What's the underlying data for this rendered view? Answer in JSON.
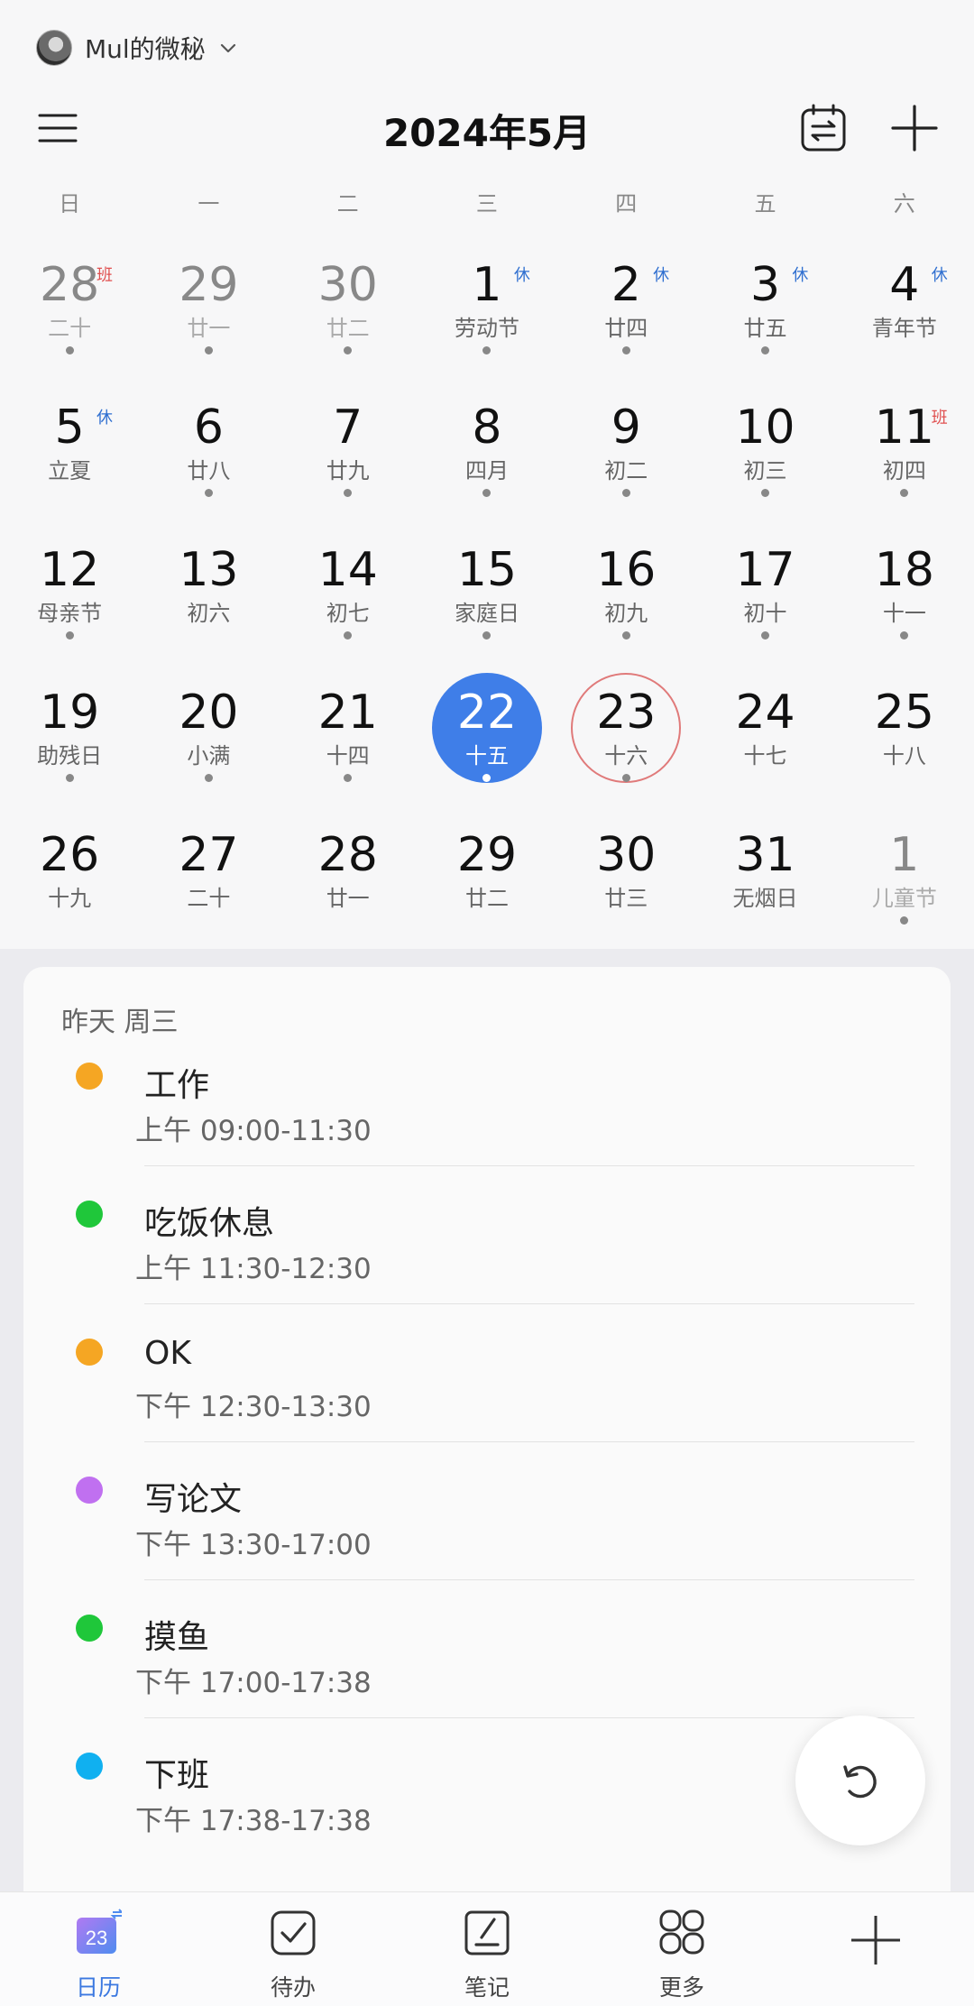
{
  "account": {
    "name": "Mul的微秘"
  },
  "header": {
    "month_title": "2024年5月"
  },
  "weekdays": [
    "日",
    "一",
    "二",
    "三",
    "四",
    "五",
    "六"
  ],
  "calendar": {
    "weeks": [
      [
        {
          "day": "28",
          "lunar": "二十",
          "muted": true,
          "badge": "班",
          "badge_type": "work",
          "dot": true
        },
        {
          "day": "29",
          "lunar": "廿一",
          "muted": true,
          "dot": true
        },
        {
          "day": "30",
          "lunar": "廿二",
          "muted": true,
          "dot": true
        },
        {
          "day": "1",
          "lunar": "劳动节",
          "badge": "休",
          "badge_type": "rest",
          "dot": true
        },
        {
          "day": "2",
          "lunar": "廿四",
          "badge": "休",
          "badge_type": "rest",
          "dot": true
        },
        {
          "day": "3",
          "lunar": "廿五",
          "badge": "休",
          "badge_type": "rest",
          "dot": true
        },
        {
          "day": "4",
          "lunar": "青年节",
          "badge": "休",
          "badge_type": "rest",
          "dot": false
        }
      ],
      [
        {
          "day": "5",
          "lunar": "立夏",
          "badge": "休",
          "badge_type": "rest",
          "dot": false
        },
        {
          "day": "6",
          "lunar": "廿八",
          "dot": true
        },
        {
          "day": "7",
          "lunar": "廿九",
          "dot": true
        },
        {
          "day": "8",
          "lunar": "四月",
          "dot": true
        },
        {
          "day": "9",
          "lunar": "初二",
          "dot": true
        },
        {
          "day": "10",
          "lunar": "初三",
          "dot": true
        },
        {
          "day": "11",
          "lunar": "初四",
          "badge": "班",
          "badge_type": "work",
          "dot": true
        }
      ],
      [
        {
          "day": "12",
          "lunar": "母亲节",
          "dot": true
        },
        {
          "day": "13",
          "lunar": "初六",
          "dot": false
        },
        {
          "day": "14",
          "lunar": "初七",
          "dot": true
        },
        {
          "day": "15",
          "lunar": "家庭日",
          "dot": true
        },
        {
          "day": "16",
          "lunar": "初九",
          "dot": true
        },
        {
          "day": "17",
          "lunar": "初十",
          "dot": true
        },
        {
          "day": "18",
          "lunar": "十一",
          "dot": true
        }
      ],
      [
        {
          "day": "19",
          "lunar": "助残日",
          "dot": true
        },
        {
          "day": "20",
          "lunar": "小满",
          "dot": true
        },
        {
          "day": "21",
          "lunar": "十四",
          "dot": true
        },
        {
          "day": "22",
          "lunar": "十五",
          "selected": true,
          "dot": true
        },
        {
          "day": "23",
          "lunar": "十六",
          "today": true,
          "dot": true
        },
        {
          "day": "24",
          "lunar": "十七",
          "dot": false
        },
        {
          "day": "25",
          "lunar": "十八",
          "dot": false
        }
      ],
      [
        {
          "day": "26",
          "lunar": "十九",
          "dot": false
        },
        {
          "day": "27",
          "lunar": "二十",
          "dot": false
        },
        {
          "day": "28",
          "lunar": "廿一",
          "dot": false
        },
        {
          "day": "29",
          "lunar": "廿二",
          "dot": false
        },
        {
          "day": "30",
          "lunar": "廿三",
          "dot": false
        },
        {
          "day": "31",
          "lunar": "无烟日",
          "dot": false
        },
        {
          "day": "1",
          "lunar": "儿童节",
          "muted": true,
          "dot": true
        }
      ]
    ]
  },
  "agenda": {
    "date_label": "昨天 周三",
    "events": [
      {
        "title": "工作",
        "time": "上午 09:00-11:30",
        "color": "#f5a623"
      },
      {
        "title": "吃饭休息",
        "time": "上午 11:30-12:30",
        "color": "#1fc73a"
      },
      {
        "title": "OK",
        "time": "下午 12:30-13:30",
        "color": "#f5a623"
      },
      {
        "title": "写论文",
        "time": "下午 13:30-17:00",
        "color": "#c070f0"
      },
      {
        "title": "摸鱼",
        "time": "下午 17:00-17:38",
        "color": "#1fc73a"
      },
      {
        "title": "下班",
        "time": "下午 17:38-17:38",
        "color": "#10b0f0"
      }
    ]
  },
  "bottom_nav": {
    "calendar_icon_day": "23",
    "items": [
      {
        "label": "日历",
        "icon": "calendar-icon",
        "active": true
      },
      {
        "label": "待办",
        "icon": "todo-check-icon",
        "active": false
      },
      {
        "label": "笔记",
        "icon": "note-icon",
        "active": false
      },
      {
        "label": "更多",
        "icon": "more-grid-icon",
        "active": false
      }
    ]
  },
  "colors": {
    "accent": "#3f7ee8",
    "rest_badge": "#2f6fd0",
    "work_badge": "#e05050",
    "today_ring": "#e07a7a"
  }
}
